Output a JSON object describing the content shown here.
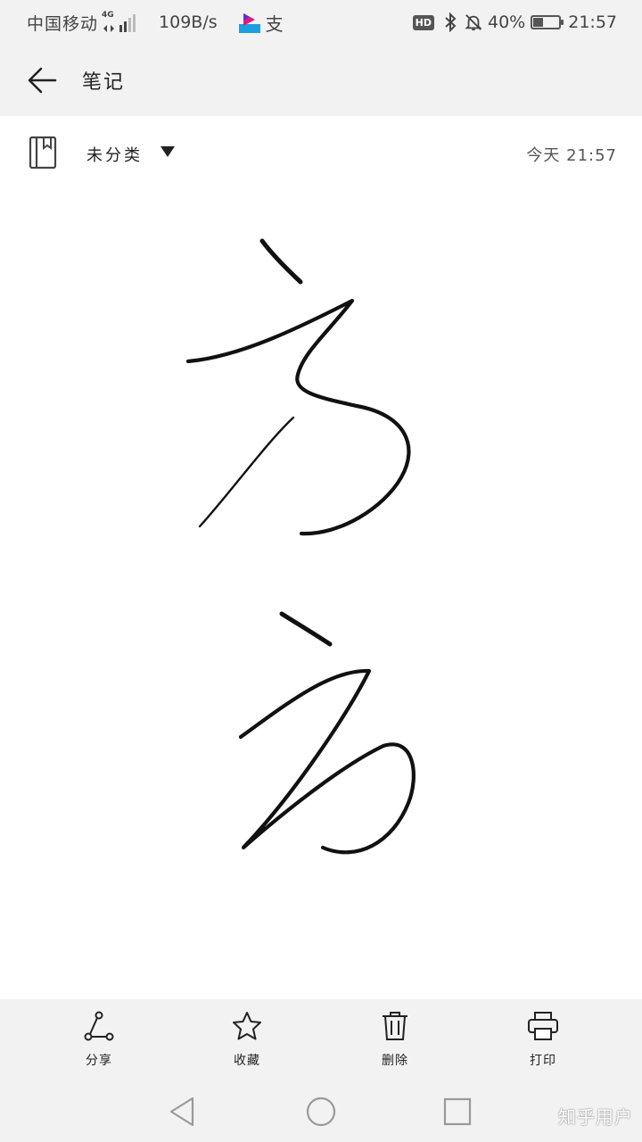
{
  "status_bar": {
    "carrier": "中国移动",
    "network": "4G",
    "speed": "109B/s",
    "pay_glyph": "支",
    "hd": "HD",
    "battery_percent": "40%",
    "battery_level": 0.4,
    "time": "21:57"
  },
  "header": {
    "title": "笔记"
  },
  "note": {
    "category": "未分类",
    "date": "今天  21:57"
  },
  "toolbar": {
    "share_label": "分享",
    "favorite_label": "收藏",
    "delete_label": "删除",
    "print_label": "打印"
  },
  "watermark": "知乎用户",
  "colors": {
    "bar_background": "#f2f2f2",
    "ink": "#111111",
    "icon": "#222222"
  }
}
